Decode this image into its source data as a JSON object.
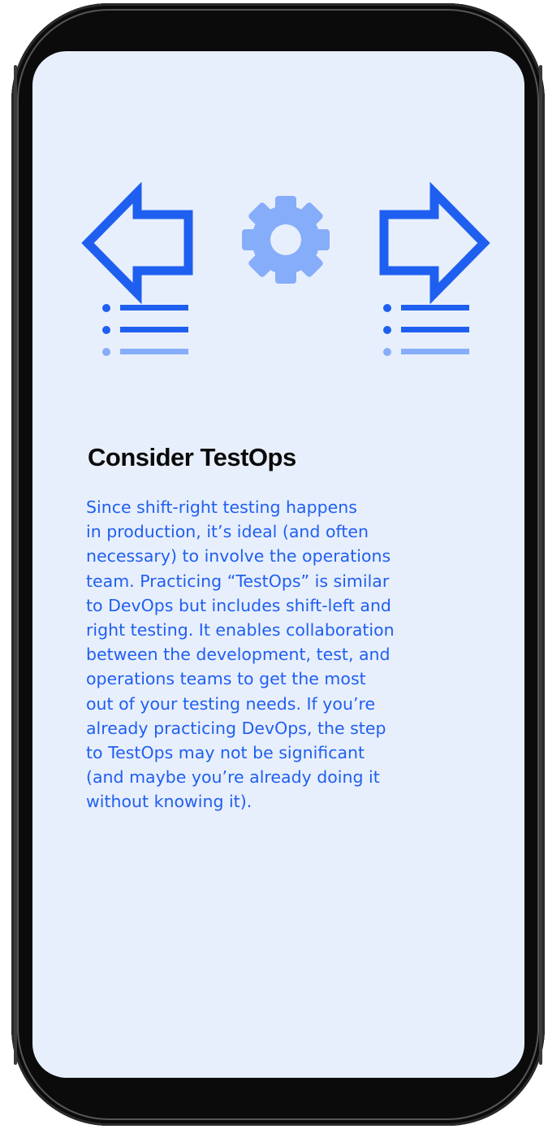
{
  "slide": {
    "title": "Consider TestOps",
    "body": "Since shift-right testing happens\nin production, it’s ideal (and often\nnecessary) to involve the operations\nteam. Practicing “TestOps” is similar\nto DevOps but includes shift-left and\nright testing. It enables collaboration\nbetween the development, test, and\noperations teams to get the most\nout of your testing needs. If you’re\nalready practicing DevOps, the step\nto TestOps may not be significant\n(and maybe you’re already doing it\nwithout knowing it)."
  },
  "illustration": {
    "icons": [
      "arrow-left-icon",
      "list-icon",
      "gear-icon",
      "arrow-right-icon",
      "list-icon"
    ],
    "colors": {
      "primary": "#1f5ff0",
      "light": "#86adfa",
      "screen_background": "#e8effc",
      "title": "#0a0a0a"
    }
  }
}
